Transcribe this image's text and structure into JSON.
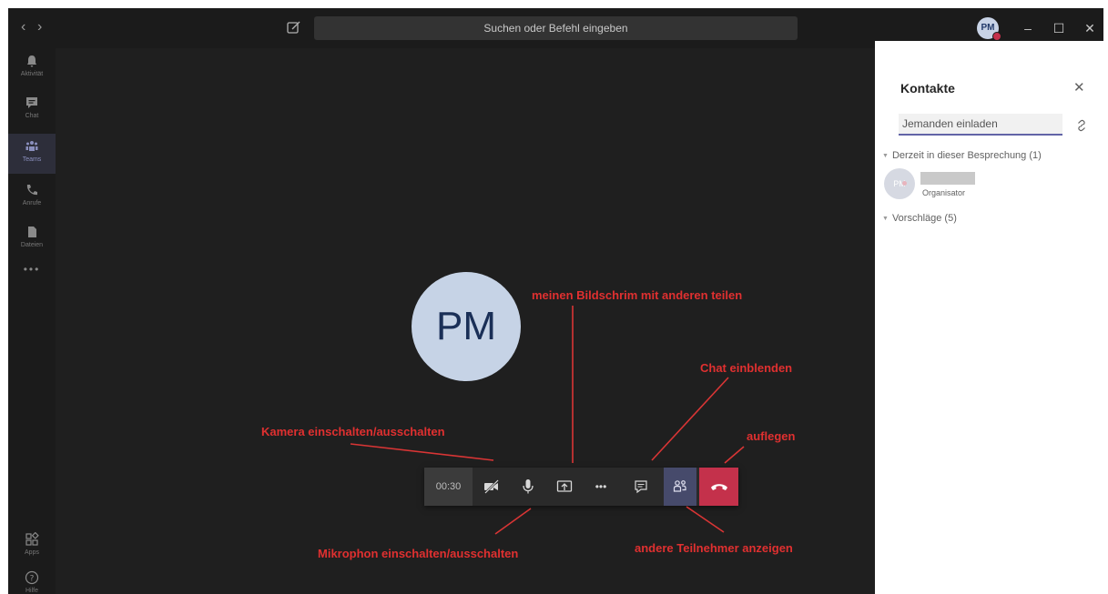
{
  "titlebar": {
    "search_placeholder": "Suchen oder Befehl eingeben",
    "avatar_initials": "PM",
    "back_glyph": "‹",
    "forward_glyph": "›",
    "minimize_glyph": "–",
    "maximize_glyph": "☐",
    "close_glyph": "✕"
  },
  "rail": {
    "items": [
      {
        "label": "Aktivität",
        "icon": "bell-icon"
      },
      {
        "label": "Chat",
        "icon": "chat-icon"
      },
      {
        "label": "Teams",
        "icon": "teams-icon"
      },
      {
        "label": "Anrufe",
        "icon": "phone-icon"
      },
      {
        "label": "Dateien",
        "icon": "file-icon"
      },
      {
        "label": "Apps",
        "icon": "apps-icon"
      },
      {
        "label": "Hilfe",
        "icon": "help-icon"
      }
    ],
    "more_glyph": "•••"
  },
  "meeting": {
    "avatar_initials": "PM",
    "timer": "00:30",
    "more_glyph": "•••"
  },
  "annotations": {
    "screen_share": "meinen Bildschrim mit anderen teilen",
    "chat": "Chat einblenden",
    "camera": "Kamera einschalten/ausschalten",
    "hangup": "auflegen",
    "microphone": "Mikrophon einschalten/ausschalten",
    "participants": "andere Teilnehmer anzeigen"
  },
  "contacts_panel": {
    "title": "Kontakte",
    "close_glyph": "✕",
    "invite_placeholder": "Jemanden einladen",
    "section_current": "Derzeit in dieser Besprechung (1)",
    "participant_initials": "PM",
    "participant_role": "Organisator",
    "section_suggestions": "Vorschläge (5)"
  },
  "colors": {
    "accent": "#6264a7",
    "hangup": "#c4314b",
    "annotation": "#e03030",
    "background": "#1f1f1f"
  }
}
